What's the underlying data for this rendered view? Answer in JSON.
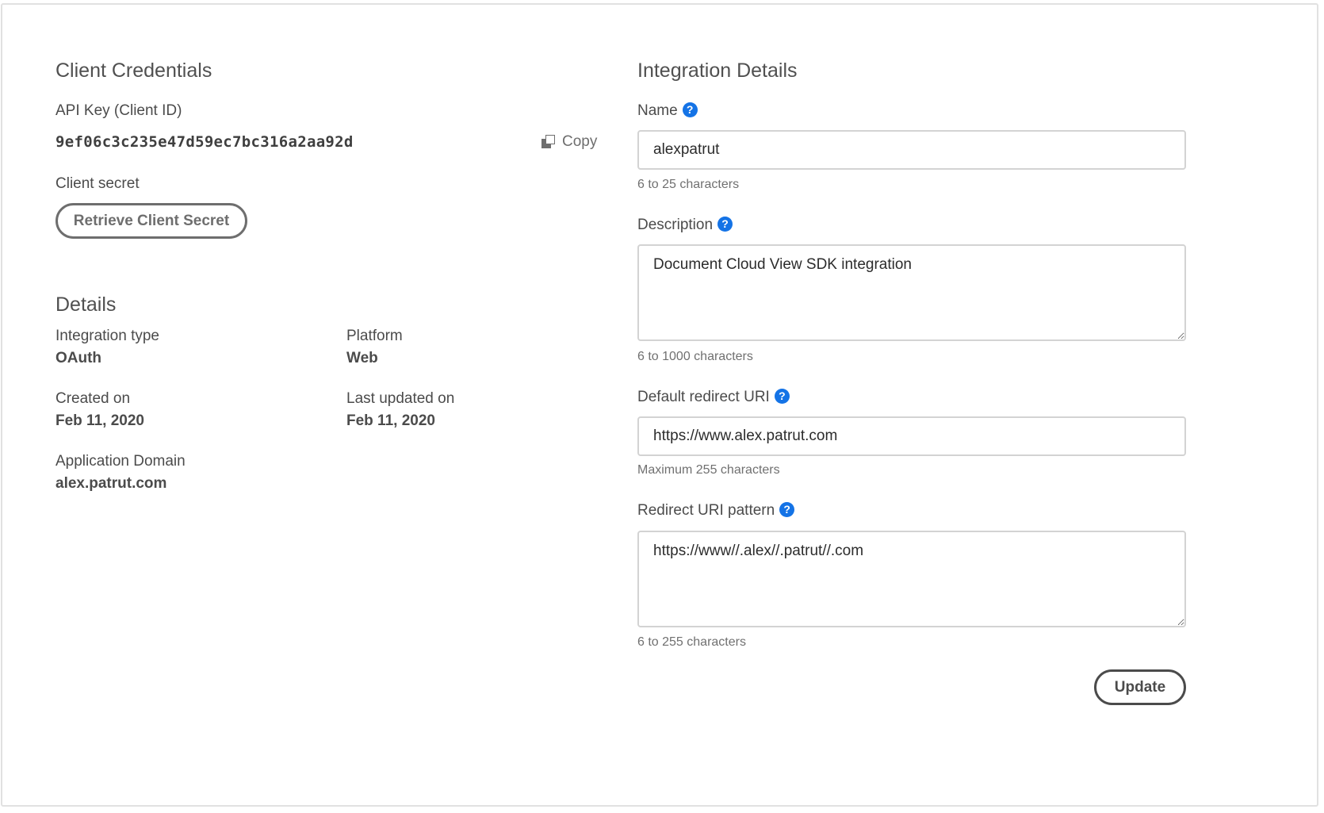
{
  "client_credentials": {
    "title": "Client Credentials",
    "api_key_label": "API Key (Client ID)",
    "api_key_value": "9ef06c3c235e47d59ec7bc316a2aa92d",
    "copy_label": "Copy",
    "client_secret_label": "Client secret",
    "retrieve_button_label": "Retrieve Client Secret"
  },
  "details": {
    "title": "Details",
    "integration_type_label": "Integration type",
    "integration_type_value": "OAuth",
    "platform_label": "Platform",
    "platform_value": "Web",
    "created_on_label": "Created on",
    "created_on_value": "Feb 11, 2020",
    "last_updated_label": "Last updated on",
    "last_updated_value": "Feb 11, 2020",
    "app_domain_label": "Application Domain",
    "app_domain_value": "alex.patrut.com"
  },
  "integration_details": {
    "title": "Integration Details",
    "help_glyph": "?",
    "name": {
      "label": "Name",
      "value": "alexpatrut",
      "hint": "6 to 25 characters"
    },
    "description": {
      "label": "Description",
      "value": "Document Cloud View SDK integration",
      "hint": "6 to 1000 characters"
    },
    "default_redirect_uri": {
      "label": "Default redirect URI",
      "value": "https://www.alex.patrut.com",
      "hint": "Maximum 255 characters"
    },
    "redirect_uri_pattern": {
      "label": "Redirect URI pattern",
      "value": "https://www//.alex//.patrut//.com",
      "hint": "6 to 255 characters"
    },
    "update_button_label": "Update"
  },
  "colors": {
    "help_icon": "#1473e6",
    "border": "#d3d3d3",
    "text": "#4b4b4b"
  }
}
